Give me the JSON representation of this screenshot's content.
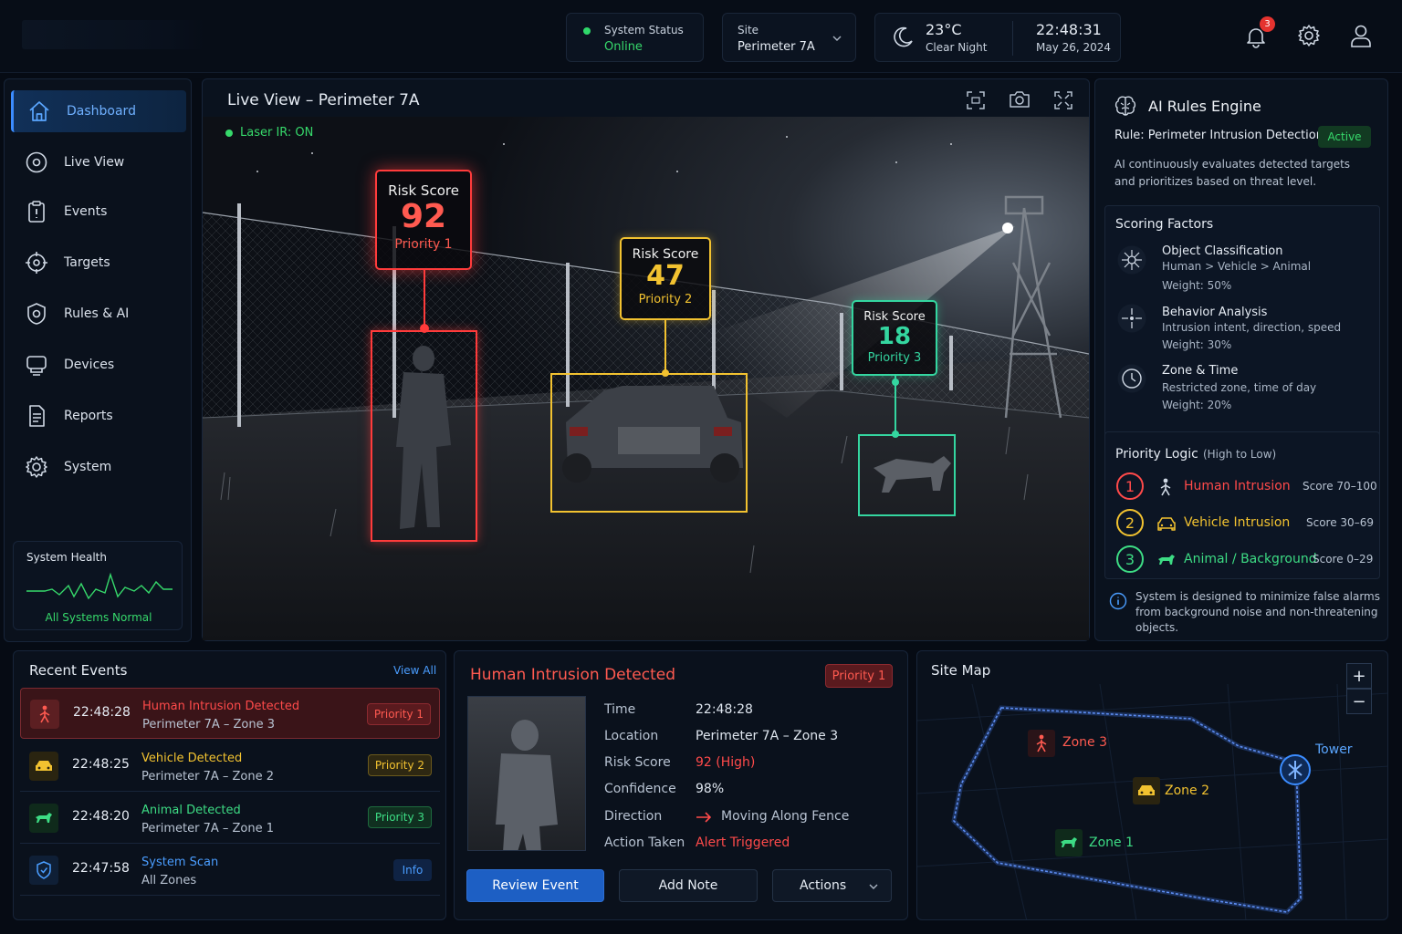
{
  "header": {
    "status_label": "System Status",
    "status_value": "Online",
    "site_label": "Site",
    "site_value": "Perimeter 7A",
    "temperature": "23°C",
    "weather": "Clear Night",
    "time": "22:48:31",
    "date": "May 26, 2024",
    "notification_count": "3"
  },
  "sidebar": {
    "items": [
      {
        "label": "Dashboard",
        "icon": "home-icon"
      },
      {
        "label": "Live View",
        "icon": "eye-icon"
      },
      {
        "label": "Events",
        "icon": "clipboard-icon"
      },
      {
        "label": "Targets",
        "icon": "crosshair-icon"
      },
      {
        "label": "Rules & AI",
        "icon": "gear-shield-icon"
      },
      {
        "label": "Devices",
        "icon": "device-icon"
      },
      {
        "label": "Reports",
        "icon": "document-icon"
      },
      {
        "label": "System",
        "icon": "gear-icon"
      }
    ],
    "health_title": "System Health",
    "health_status": "All Systems Normal"
  },
  "live": {
    "title": "Live View – Perimeter 7A",
    "laser": "Laser IR: ON",
    "targets": [
      {
        "label": "Risk Score",
        "score": "92",
        "priority": "Priority 1",
        "color": "#ff3b3b"
      },
      {
        "label": "Risk Score",
        "score": "47",
        "priority": "Priority 2",
        "color": "#f2c230"
      },
      {
        "label": "Risk Score",
        "score": "18",
        "priority": "Priority 3",
        "color": "#34d6a0"
      }
    ]
  },
  "rules": {
    "title": "AI Rules Engine",
    "rule": "Rule: Perimeter Intrusion Detection",
    "status": "Active",
    "desc1": "AI continuously evaluates detected targets",
    "desc2": "and prioritizes based on threat level.",
    "factors_title": "Scoring Factors",
    "factors": [
      {
        "title": "Object Classification",
        "sub": "Human > Vehicle > Animal",
        "weight": "Weight: 50%",
        "icon": "network-icon"
      },
      {
        "title": "Behavior Analysis",
        "sub": "Intrusion intent, direction, speed",
        "weight": "Weight: 30%",
        "icon": "target-icon"
      },
      {
        "title": "Zone & Time",
        "sub": "Restricted zone, time of day",
        "weight": "Weight: 20%",
        "icon": "clock-icon"
      }
    ],
    "logic_title": "Priority Logic",
    "logic_sub": "(High to Low)",
    "logic": [
      {
        "num": "1",
        "label": "Human Intrusion",
        "score": "Score 70–100",
        "color": "#ff4a4a"
      },
      {
        "num": "2",
        "label": "Vehicle Intrusion",
        "score": "Score 30–69",
        "color": "#f2c230"
      },
      {
        "num": "3",
        "label": "Animal / Background",
        "score": "Score 0–29",
        "color": "#3ddc84"
      }
    ],
    "note1": "System is designed to minimize false alarms",
    "note2": "from background noise and non-threatening",
    "note3": "objects."
  },
  "events": {
    "title": "Recent Events",
    "view_all": "View All",
    "items": [
      {
        "time": "22:48:28",
        "title": "Human Intrusion Detected",
        "loc": "Perimeter 7A – Zone 3",
        "badge": "Priority 1",
        "color": "#ff4a4a"
      },
      {
        "time": "22:48:25",
        "title": "Vehicle Detected",
        "loc": "Perimeter 7A – Zone 2",
        "badge": "Priority 2",
        "color": "#f2c230"
      },
      {
        "time": "22:48:20",
        "title": "Animal Detected",
        "loc": "Perimeter 7A – Zone 1",
        "badge": "Priority 3",
        "color": "#3ddc84"
      },
      {
        "time": "22:47:58",
        "title": "System Scan",
        "loc": "All Zones",
        "badge": "Info",
        "color": "#4a9dff"
      }
    ]
  },
  "detail": {
    "title": "Human Intrusion Detected",
    "badge": "Priority 1",
    "time_label": "Time",
    "time": "22:48:28",
    "loc_label": "Location",
    "loc": "Perimeter 7A – Zone 3",
    "risk_label": "Risk Score",
    "risk": "92 (High)",
    "conf_label": "Confidence",
    "conf": "98%",
    "dir_label": "Direction",
    "dir": "Moving Along Fence",
    "action_label": "Action Taken",
    "action": "Alert Triggered",
    "review": "Review Event",
    "note": "Add Note",
    "actions": "Actions"
  },
  "map": {
    "title": "Site Map",
    "zone3": "Zone 3",
    "zone2": "Zone 2",
    "zone1": "Zone 1",
    "tower": "Tower",
    "zoom_in": "+",
    "zoom_out": "−"
  }
}
